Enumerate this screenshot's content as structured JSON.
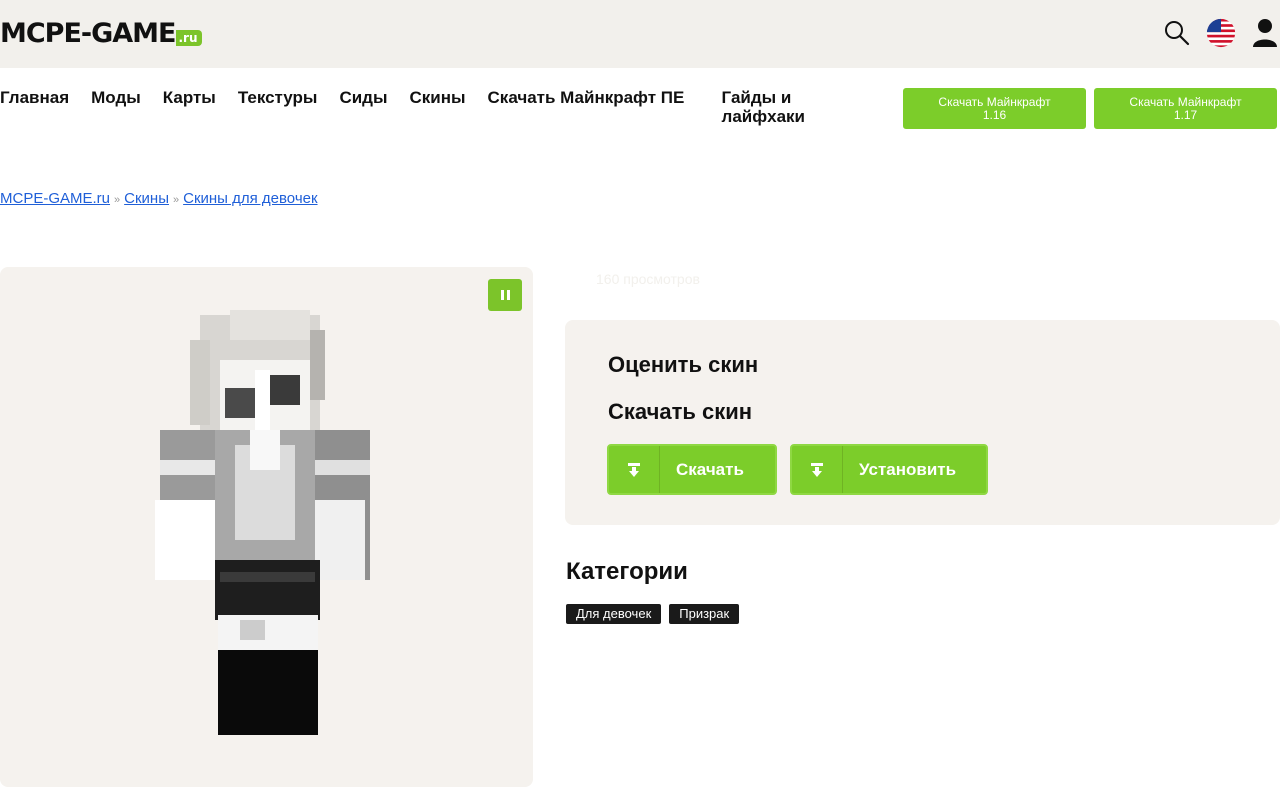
{
  "site": {
    "logo_main": "MCPE-GAME",
    "logo_suffix": ".ru"
  },
  "nav": {
    "items": [
      "Главная",
      "Моды",
      "Карты",
      "Текстуры",
      "Сиды",
      "Скины",
      "Скачать Майнкрафт ПЕ",
      "Гайды и лайфхаки"
    ]
  },
  "download_buttons": [
    {
      "line1": "Скачать Майнкрафт",
      "line2": "1.16"
    },
    {
      "line1": "Скачать Майнкрафт",
      "line2": "1.17"
    }
  ],
  "breadcrumb": {
    "items": [
      "MCPE-GAME.ru",
      "Скины",
      "Скины для девочек"
    ],
    "separator": "»"
  },
  "skin": {
    "views": "160 просмотров",
    "rate_title": "Оценить скин",
    "download_title": "Скачать скин",
    "download_label": "Скачать",
    "install_label": "Установить"
  },
  "categories": {
    "title": "Категории",
    "tags": [
      "Для девочек",
      "Призрак"
    ]
  },
  "colors": {
    "accent": "#7ccd2a",
    "panel_bg": "#f5f2ee",
    "topbar_bg": "#f2f0ec",
    "link": "#1f5fd8"
  },
  "icons": [
    "search-icon",
    "us-flag-icon",
    "user-icon",
    "pause-icon",
    "download-icon"
  ]
}
